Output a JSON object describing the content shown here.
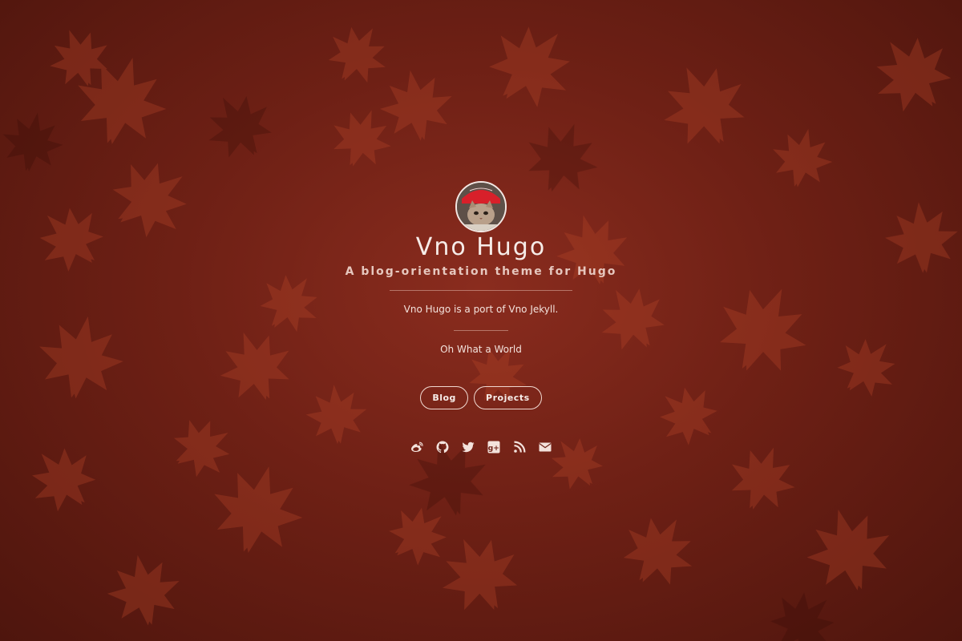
{
  "header": {
    "title": "Vno Hugo",
    "subtitle": "A blog-orientation theme for Hugo"
  },
  "intro": {
    "description": "Vno Hugo is a port of Vno Jekyll.",
    "tagline": "Oh What a World"
  },
  "nav": {
    "blog_label": "Blog",
    "projects_label": "Projects"
  },
  "social": [
    {
      "icon": "weibo-icon"
    },
    {
      "icon": "github-icon"
    },
    {
      "icon": "twitter-icon"
    },
    {
      "icon": "google-plus-icon"
    },
    {
      "icon": "rss-icon"
    },
    {
      "icon": "email-icon"
    }
  ],
  "colors": {
    "background": "#6e2015",
    "leaf": "#b5452a",
    "text": "#f3e2dc",
    "border": "#f0d8d0"
  }
}
